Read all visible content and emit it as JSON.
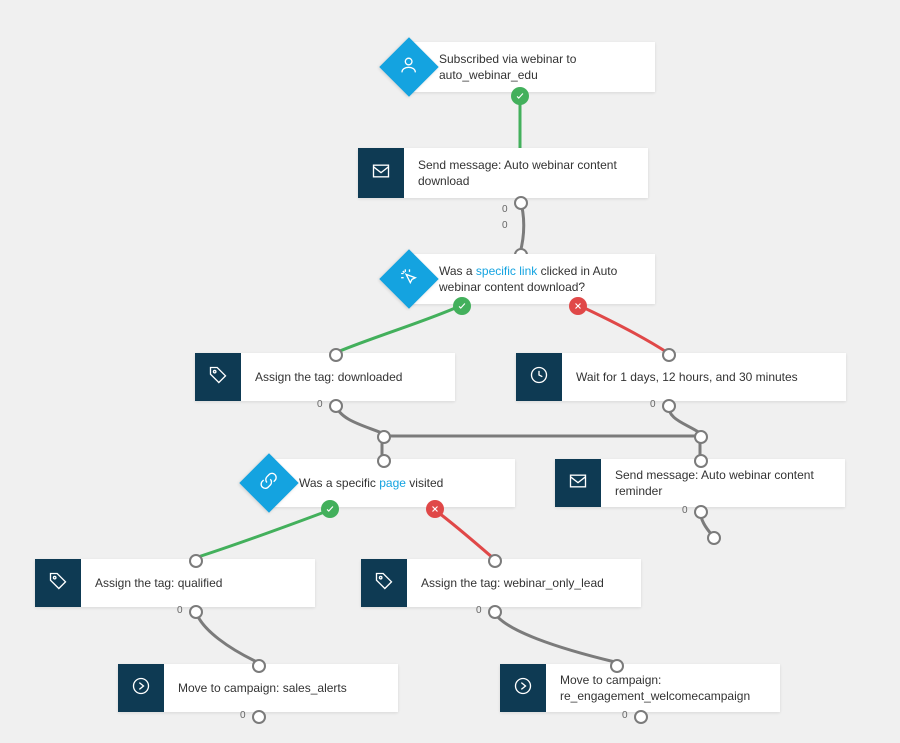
{
  "delay_label": "0",
  "nodes": {
    "start": {
      "text": "Subscribed via webinar to auto_webinar_edu"
    },
    "msg1": {
      "text": "Send message: Auto webinar content download"
    },
    "cond_click": {
      "prefix": "Was a ",
      "link": "specific link",
      "suffix": " clicked in Auto webinar content download?"
    },
    "tag_downloaded": {
      "text": "Assign the tag: downloaded"
    },
    "wait": {
      "text": "Wait for 1 days, 12 hours, and 30 minutes"
    },
    "cond_page": {
      "prefix": "Was a specific ",
      "link": "page",
      "suffix": " visited"
    },
    "msg_reminder": {
      "text": "Send message: Auto webinar content reminder"
    },
    "tag_qualified": {
      "text": "Assign the tag: qualified"
    },
    "tag_webinar_only": {
      "text": "Assign the tag: webinar_only_lead"
    },
    "move_sales": {
      "text": "Move to campaign: sales_alerts"
    },
    "move_reengage": {
      "text": "Move to campaign: re_engagement_welcomecampaign"
    }
  }
}
